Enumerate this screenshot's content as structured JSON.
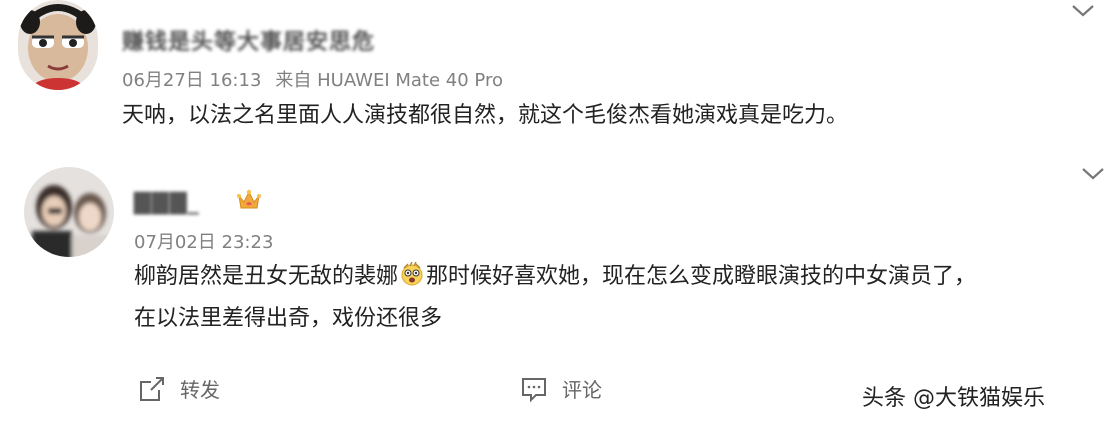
{
  "comments": [
    {
      "username": "赚钱是头等大事居安思危",
      "date": "06月27日 16:13",
      "source": "来自 HUAWEI Mate 40 Pro",
      "text": "天呐，以法之名里面人人演技都很自然，就这个毛俊杰看她演戏真是吃力。",
      "avatar_icon": "cartoon-girl-avatar"
    },
    {
      "username": "▇▇▇_",
      "date": "07月02日 23:23",
      "text_before_emoji": "柳韵居然是丑女无敌的裴娜",
      "text_after_emoji": "那时候好喜欢她，现在怎么变成瞪眼演技的中女演员了，",
      "text_line2": "在以法里差得出奇，戏份还很多",
      "emoji_icon": "shocked-face-emoji",
      "badge_icon": "crown-icon",
      "avatar_icon": "blurred-photo-avatar"
    }
  ],
  "actions": {
    "repost_label": "转发",
    "comment_label": "评论"
  },
  "watermark": "头条 @大铁猫娱乐",
  "colors": {
    "text": "#222222",
    "meta": "#808080",
    "crown": "#f2a93b"
  }
}
